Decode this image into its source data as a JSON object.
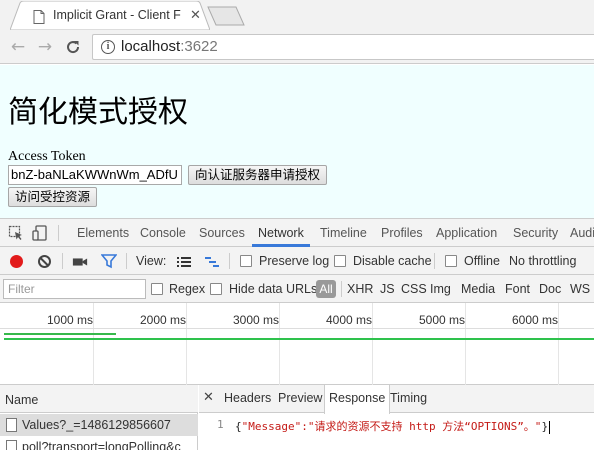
{
  "browser": {
    "tab_title": "Implicit Grant - Client F",
    "url_host": "localhost",
    "url_port": ":3622"
  },
  "page": {
    "title": "简化模式授权",
    "token_label": "Access Token",
    "token_value": "bnZ-baNLaKWWnWm_ADfU",
    "request_button": "向认证服务器申请授权",
    "access_button": "访问受控资源",
    "background": "#f0ffff"
  },
  "devtools": {
    "tabs": [
      "Elements",
      "Console",
      "Sources",
      "Network",
      "Timeline",
      "Profiles",
      "Application",
      "Security",
      "Audi"
    ],
    "active_tab": "Network",
    "toolbar": {
      "view_label": "View:",
      "preserve_log": "Preserve log",
      "disable_cache": "Disable cache",
      "offline": "Offline",
      "throttling": "No throttling"
    },
    "filter": {
      "placeholder": "Filter",
      "regex": "Regex",
      "hide_data_urls": "Hide data URLs",
      "types": [
        "All",
        "XHR",
        "JS",
        "CSS",
        "Img",
        "Media",
        "Font",
        "Doc",
        "WS"
      ]
    },
    "timeline_labels": [
      "1000 ms",
      "2000 ms",
      "3000 ms",
      "4000 ms",
      "5000 ms",
      "6000 ms"
    ],
    "name_header": "Name",
    "requests": [
      "Values?_=1486129856607",
      "poll?transport=longPolling&c"
    ],
    "detail_tabs": [
      "Headers",
      "Preview",
      "Response",
      "Timing"
    ],
    "active_detail_tab": "Response",
    "response": {
      "line_number": "1",
      "open": "{",
      "body": "\"Message\":\"请求的资源不支持 http 方法“OPTIONS”。\"",
      "close": "}"
    },
    "accent_color": "#3879d9",
    "record_color": "#e21b1b"
  }
}
